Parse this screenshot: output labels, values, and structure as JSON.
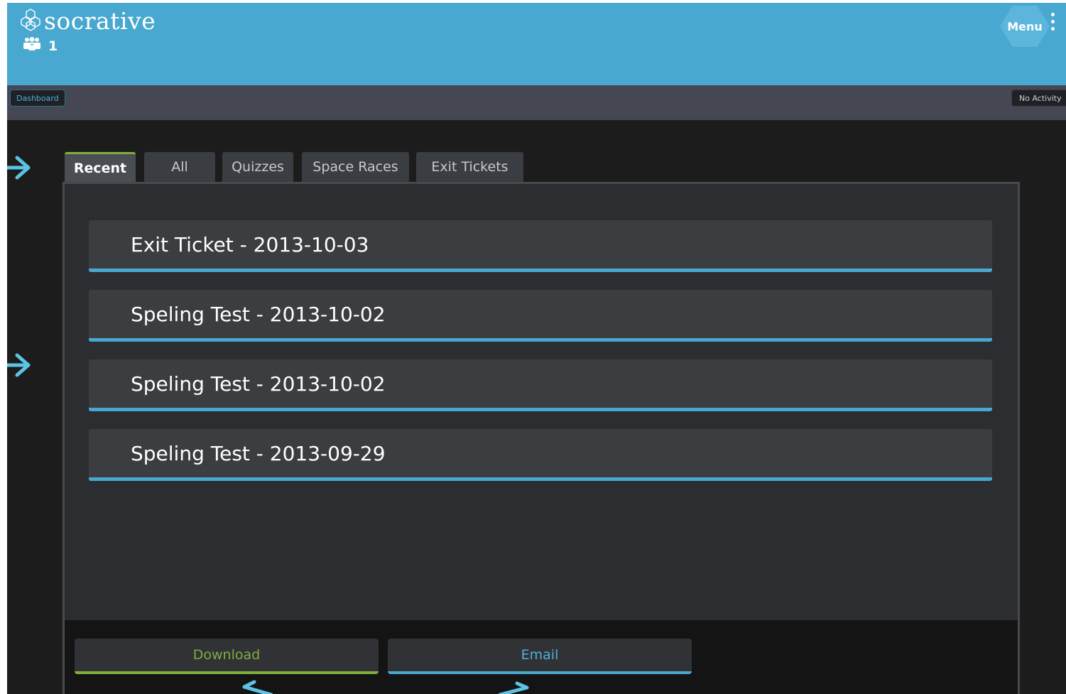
{
  "header": {
    "logo_text": "socrative",
    "student_count": "1",
    "menu_label": "Menu"
  },
  "status_bar": {
    "dashboard_label": "Dashboard",
    "activity_status": "No Activity"
  },
  "tabs": [
    {
      "label": "Recent",
      "active": true
    },
    {
      "label": "All",
      "active": false
    },
    {
      "label": "Quizzes",
      "active": false
    },
    {
      "label": "Space Races",
      "active": false
    },
    {
      "label": "Exit Tickets",
      "active": false
    }
  ],
  "reports": [
    {
      "title": "Exit Ticket - 2013-10-03"
    },
    {
      "title": "Speling Test - 2013-10-02"
    },
    {
      "title": "Speling Test - 2013-10-02"
    },
    {
      "title": "Speling Test - 2013-09-29"
    }
  ],
  "actions": {
    "download_label": "Download",
    "email_label": "Email"
  },
  "colors": {
    "brand_blue": "#49a8d0",
    "accent_green": "#7fae3c",
    "annotation_arrow": "#5bc3e3"
  }
}
